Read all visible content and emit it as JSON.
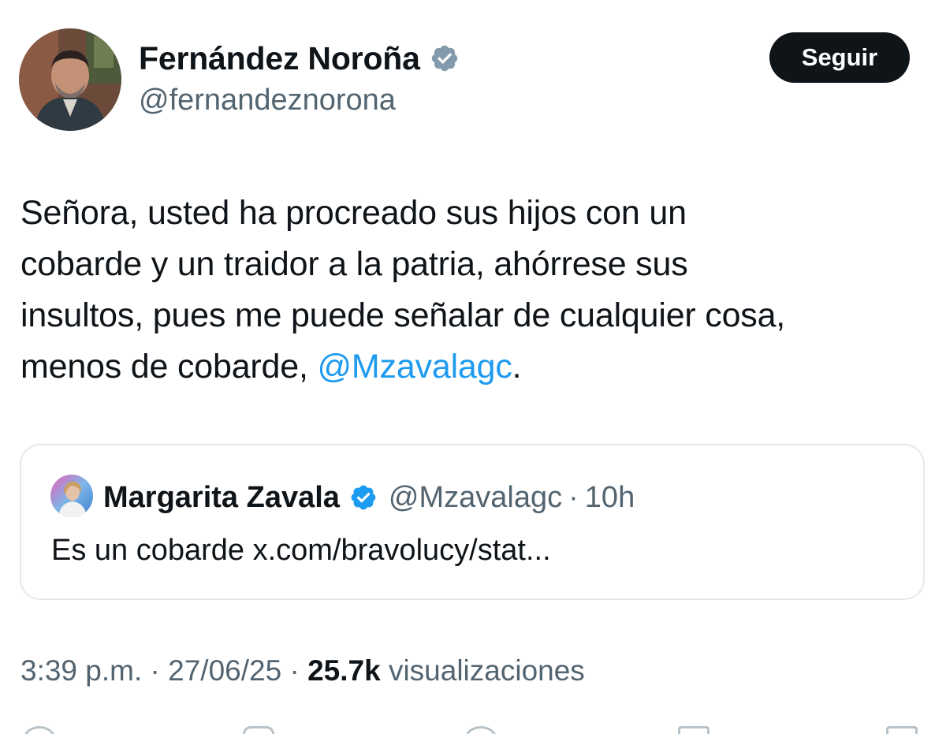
{
  "author": {
    "name": "Fernández Noroña",
    "handle": "@fernandeznorona",
    "verified_icon": "verified-badge-icon",
    "verified_color": "#829aab"
  },
  "follow_button": {
    "label": "Seguir"
  },
  "tweet": {
    "lines": [
      "Señora, usted ha procreado sus hijos con un",
      "cobarde y un traidor a la patria, ahórrese sus",
      "insultos, pues me puede señalar de cualquier cosa,",
      "menos de cobarde, "
    ],
    "mention": "@Mzavalagc",
    "trailing": ".",
    "mention_color": "#1d9bf0"
  },
  "quote": {
    "name": "Margarita Zavala",
    "handle": "@Mzavalagc",
    "separator": "·",
    "time": "10h",
    "text": "Es un cobarde x.com/bravolucy/stat...",
    "verified_color": "#1d9bf0"
  },
  "meta": {
    "time": "3:39 p.m.",
    "sep1": " · ",
    "date": "27/06/25",
    "sep2": " · ",
    "views_count": "25.7k",
    "views_label": " visualizaciones"
  },
  "colors": {
    "text": "#0f1419",
    "secondary": "#536471",
    "border": "#e6e9eb",
    "button_bg": "#0f1419"
  }
}
